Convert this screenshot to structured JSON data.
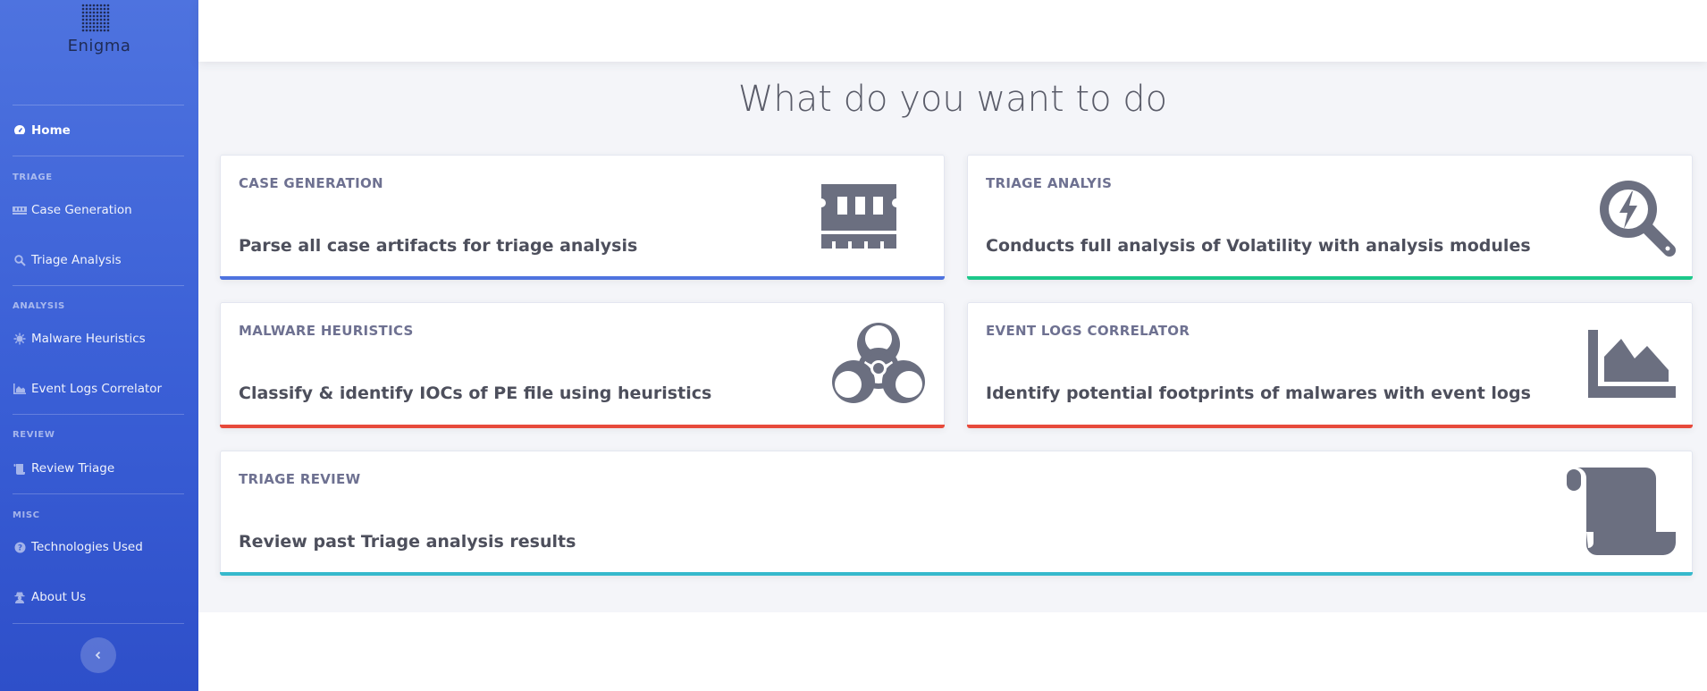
{
  "brand": {
    "name": "Enigma"
  },
  "sidebar": {
    "home": {
      "label": "Home",
      "icon": "dashboard-gauge-icon"
    },
    "sections": [
      {
        "heading": "TRIAGE",
        "items": [
          {
            "label": "Case Generation",
            "icon": "memory-icon"
          },
          {
            "label": "Triage Analysis",
            "icon": "search-icon"
          }
        ]
      },
      {
        "heading": "ANALYSIS",
        "items": [
          {
            "label": "Malware Heuristics",
            "icon": "virus-icon"
          },
          {
            "label": "Event Logs Correlator",
            "icon": "chart-area-icon"
          }
        ]
      },
      {
        "heading": "REVIEW",
        "items": [
          {
            "label": "Review Triage",
            "icon": "scroll-icon"
          }
        ]
      },
      {
        "heading": "MISC",
        "items": [
          {
            "label": "Technologies Used",
            "icon": "question-circle-icon"
          },
          {
            "label": "About Us",
            "icon": "user-secret-icon"
          }
        ]
      }
    ],
    "toggle_icon": "chevron-left-icon"
  },
  "main": {
    "title": "What do you want to do",
    "cards": [
      {
        "label": "CASE GENERATION",
        "description": "Parse all case artifacts for triage analysis",
        "icon": "memory-icon",
        "accent": "#4e73df"
      },
      {
        "label": "TRIAGE ANALYIS",
        "description": "Conducts full analysis of Volatility with analysis modules",
        "icon": "search-bolt-icon",
        "accent": "#1cc88a"
      },
      {
        "label": "MALWARE HEURISTICS",
        "description": "Classify & identify IOCs of PE file using heuristics",
        "icon": "biohazard-icon",
        "accent": "#e74a3b"
      },
      {
        "label": "EVENT LOGS CORRELATOR",
        "description": "Identify potential footprints of malwares with event logs",
        "icon": "chart-area-icon",
        "accent": "#e74a3b"
      },
      {
        "label": "TRIAGE REVIEW",
        "description": "Review past Triage analysis results",
        "icon": "scroll-icon",
        "accent": "#36b9cc"
      }
    ]
  },
  "colors": {
    "sidebar_top": "#4e73df",
    "sidebar_bottom": "#2e4fc9",
    "icon_gray": "#6b6f80",
    "background": "#f4f5f9"
  }
}
